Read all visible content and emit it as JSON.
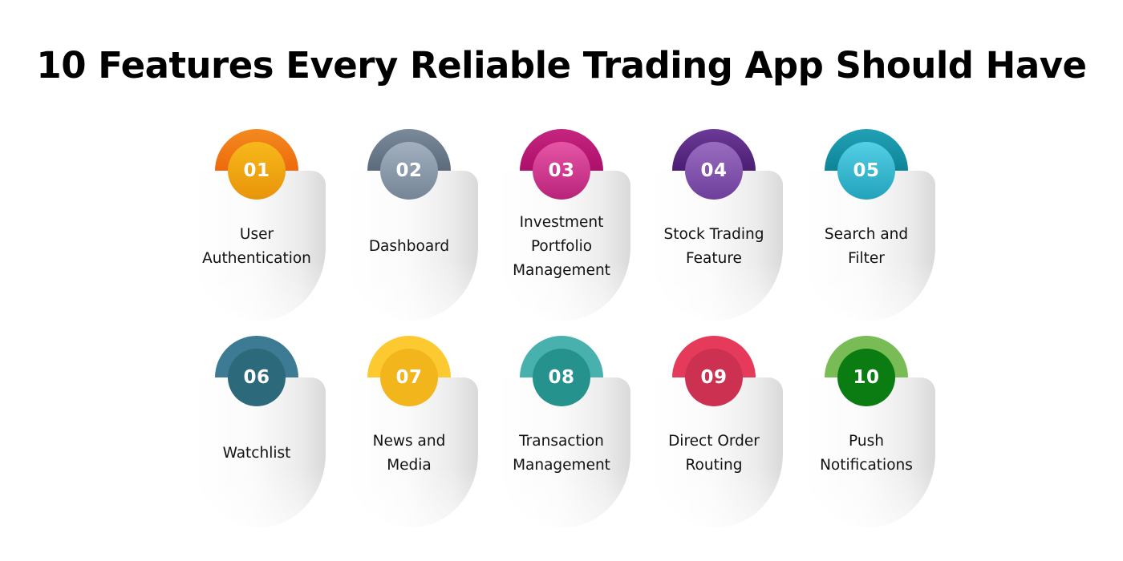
{
  "title": "10 Features Every Reliable Trading App Should Have",
  "features": [
    {
      "number": "01",
      "lines": [
        "User",
        "Authentication"
      ],
      "arc_color": "#ee6a0e",
      "arc_color_2": "#f28a1e",
      "badge_color": "#f7b81a",
      "badge_color_2": "#e8940a"
    },
    {
      "number": "02",
      "lines": [
        "Dashboard"
      ],
      "arc_color": "#5c6b7c",
      "arc_color_2": "#7b8a9a",
      "badge_color": "#a2b0bf",
      "badge_color_2": "#758596"
    },
    {
      "number": "03",
      "lines": [
        "Investment",
        "Portfolio",
        "Management"
      ],
      "arc_color": "#ad0f6a",
      "arc_color_2": "#c4257f",
      "badge_color": "#e655a6",
      "badge_color_2": "#b8237a"
    },
    {
      "number": "04",
      "lines": [
        "Stock Trading",
        "Feature"
      ],
      "arc_color": "#4b1d73",
      "arc_color_2": "#6c3a97",
      "badge_color": "#9a6cc0",
      "badge_color_2": "#6e3f9b"
    },
    {
      "number": "05",
      "lines": [
        "Search and",
        "Filter"
      ],
      "arc_color": "#0d8599",
      "arc_color_2": "#23a0b5",
      "badge_color": "#54cfe6",
      "badge_color_2": "#22a2bb"
    },
    {
      "number": "06",
      "lines": [
        "Watchlist"
      ],
      "arc_color": "#3d7a93",
      "arc_color_2": "#3d7a93",
      "badge_color": "#2c6a7b",
      "badge_color_2": "#2c6a7b"
    },
    {
      "number": "07",
      "lines": [
        "News and",
        "Media"
      ],
      "arc_color": "#fcc930",
      "arc_color_2": "#fcc930",
      "badge_color": "#f2b51c",
      "badge_color_2": "#f2b51c"
    },
    {
      "number": "08",
      "lines": [
        "Transaction",
        "Management"
      ],
      "arc_color": "#48b0ad",
      "arc_color_2": "#48b0ad",
      "badge_color": "#25928d",
      "badge_color_2": "#25928d"
    },
    {
      "number": "09",
      "lines": [
        "Direct Order",
        "Routing"
      ],
      "arc_color": "#e63a5b",
      "arc_color_2": "#e63a5b",
      "badge_color": "#cc3152",
      "badge_color_2": "#cc3152"
    },
    {
      "number": "10",
      "lines": [
        "Push",
        "Notifications"
      ],
      "arc_color": "#79bb54",
      "arc_color_2": "#79bb54",
      "badge_color": "#0b7c12",
      "badge_color_2": "#0b7c12"
    }
  ]
}
